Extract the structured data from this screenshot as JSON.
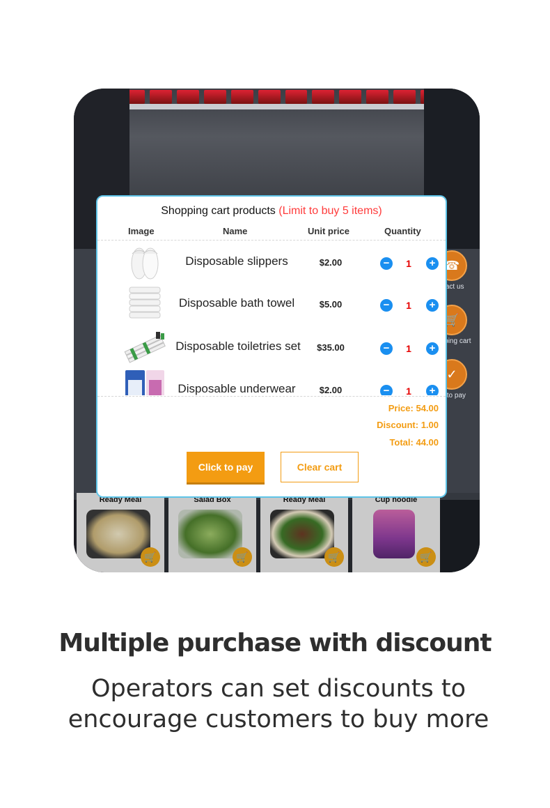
{
  "kiosk": {
    "side_menu": [
      {
        "label": "ntact us",
        "icon": "phone-icon"
      },
      {
        "label": "hopping cart",
        "icon": "cart-icon"
      },
      {
        "label": "ck to pay",
        "icon": "pay-icon"
      }
    ],
    "food_tiles": [
      {
        "name": "Ready Meal"
      },
      {
        "name": "Salad Box"
      },
      {
        "name": "Ready Meal"
      },
      {
        "name": "Cup noodle"
      }
    ]
  },
  "cart": {
    "title": "Shopping cart products ",
    "limit_note": "(Limit to buy 5 items)",
    "columns": {
      "image": "Image",
      "name": "Name",
      "unit_price": "Unit price",
      "quantity": "Quantity"
    },
    "items": [
      {
        "name": "Disposable slippers",
        "price": "$2.00",
        "qty": "1",
        "icon": "slippers-icon"
      },
      {
        "name": "Disposable bath towel",
        "price": "$5.00",
        "qty": "1",
        "icon": "towel-icon"
      },
      {
        "name": "Disposable toiletries set",
        "price": "$35.00",
        "qty": "1",
        "icon": "toiletries-icon"
      },
      {
        "name": "Disposable underwear",
        "price": "$2.00",
        "qty": "1",
        "icon": "underwear-icon"
      }
    ],
    "summary": {
      "price": "Price: 54.00",
      "discount": "Discount: 1.00",
      "total": "Total: 44.00"
    },
    "pay_label": "Click to pay",
    "clear_label": "Clear cart"
  },
  "headline": "Multiple purchase with discount",
  "subline": "Operators can set discounts to encourage customers to buy more",
  "colors": {
    "accent": "#f39c12",
    "limit": "#ff3b3b",
    "qty_button": "#1a8ff0",
    "dialog_border": "#5ec4e8"
  }
}
